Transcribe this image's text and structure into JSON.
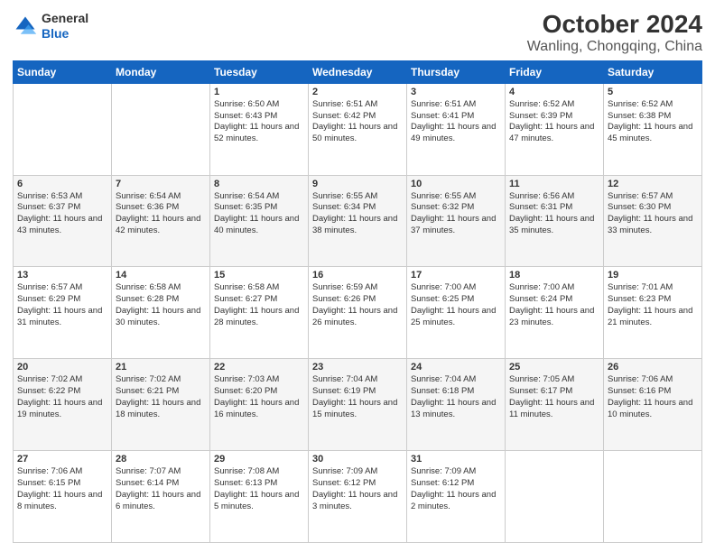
{
  "logo": {
    "general": "General",
    "blue": "Blue"
  },
  "header": {
    "title": "October 2024",
    "subtitle": "Wanling, Chongqing, China"
  },
  "days_of_week": [
    "Sunday",
    "Monday",
    "Tuesday",
    "Wednesday",
    "Thursday",
    "Friday",
    "Saturday"
  ],
  "weeks": [
    [
      {
        "day": "",
        "info": ""
      },
      {
        "day": "",
        "info": ""
      },
      {
        "day": "1",
        "info": "Sunrise: 6:50 AM\nSunset: 6:43 PM\nDaylight: 11 hours and 52 minutes."
      },
      {
        "day": "2",
        "info": "Sunrise: 6:51 AM\nSunset: 6:42 PM\nDaylight: 11 hours and 50 minutes."
      },
      {
        "day": "3",
        "info": "Sunrise: 6:51 AM\nSunset: 6:41 PM\nDaylight: 11 hours and 49 minutes."
      },
      {
        "day": "4",
        "info": "Sunrise: 6:52 AM\nSunset: 6:39 PM\nDaylight: 11 hours and 47 minutes."
      },
      {
        "day": "5",
        "info": "Sunrise: 6:52 AM\nSunset: 6:38 PM\nDaylight: 11 hours and 45 minutes."
      }
    ],
    [
      {
        "day": "6",
        "info": "Sunrise: 6:53 AM\nSunset: 6:37 PM\nDaylight: 11 hours and 43 minutes."
      },
      {
        "day": "7",
        "info": "Sunrise: 6:54 AM\nSunset: 6:36 PM\nDaylight: 11 hours and 42 minutes."
      },
      {
        "day": "8",
        "info": "Sunrise: 6:54 AM\nSunset: 6:35 PM\nDaylight: 11 hours and 40 minutes."
      },
      {
        "day": "9",
        "info": "Sunrise: 6:55 AM\nSunset: 6:34 PM\nDaylight: 11 hours and 38 minutes."
      },
      {
        "day": "10",
        "info": "Sunrise: 6:55 AM\nSunset: 6:32 PM\nDaylight: 11 hours and 37 minutes."
      },
      {
        "day": "11",
        "info": "Sunrise: 6:56 AM\nSunset: 6:31 PM\nDaylight: 11 hours and 35 minutes."
      },
      {
        "day": "12",
        "info": "Sunrise: 6:57 AM\nSunset: 6:30 PM\nDaylight: 11 hours and 33 minutes."
      }
    ],
    [
      {
        "day": "13",
        "info": "Sunrise: 6:57 AM\nSunset: 6:29 PM\nDaylight: 11 hours and 31 minutes."
      },
      {
        "day": "14",
        "info": "Sunrise: 6:58 AM\nSunset: 6:28 PM\nDaylight: 11 hours and 30 minutes."
      },
      {
        "day": "15",
        "info": "Sunrise: 6:58 AM\nSunset: 6:27 PM\nDaylight: 11 hours and 28 minutes."
      },
      {
        "day": "16",
        "info": "Sunrise: 6:59 AM\nSunset: 6:26 PM\nDaylight: 11 hours and 26 minutes."
      },
      {
        "day": "17",
        "info": "Sunrise: 7:00 AM\nSunset: 6:25 PM\nDaylight: 11 hours and 25 minutes."
      },
      {
        "day": "18",
        "info": "Sunrise: 7:00 AM\nSunset: 6:24 PM\nDaylight: 11 hours and 23 minutes."
      },
      {
        "day": "19",
        "info": "Sunrise: 7:01 AM\nSunset: 6:23 PM\nDaylight: 11 hours and 21 minutes."
      }
    ],
    [
      {
        "day": "20",
        "info": "Sunrise: 7:02 AM\nSunset: 6:22 PM\nDaylight: 11 hours and 19 minutes."
      },
      {
        "day": "21",
        "info": "Sunrise: 7:02 AM\nSunset: 6:21 PM\nDaylight: 11 hours and 18 minutes."
      },
      {
        "day": "22",
        "info": "Sunrise: 7:03 AM\nSunset: 6:20 PM\nDaylight: 11 hours and 16 minutes."
      },
      {
        "day": "23",
        "info": "Sunrise: 7:04 AM\nSunset: 6:19 PM\nDaylight: 11 hours and 15 minutes."
      },
      {
        "day": "24",
        "info": "Sunrise: 7:04 AM\nSunset: 6:18 PM\nDaylight: 11 hours and 13 minutes."
      },
      {
        "day": "25",
        "info": "Sunrise: 7:05 AM\nSunset: 6:17 PM\nDaylight: 11 hours and 11 minutes."
      },
      {
        "day": "26",
        "info": "Sunrise: 7:06 AM\nSunset: 6:16 PM\nDaylight: 11 hours and 10 minutes."
      }
    ],
    [
      {
        "day": "27",
        "info": "Sunrise: 7:06 AM\nSunset: 6:15 PM\nDaylight: 11 hours and 8 minutes."
      },
      {
        "day": "28",
        "info": "Sunrise: 7:07 AM\nSunset: 6:14 PM\nDaylight: 11 hours and 6 minutes."
      },
      {
        "day": "29",
        "info": "Sunrise: 7:08 AM\nSunset: 6:13 PM\nDaylight: 11 hours and 5 minutes."
      },
      {
        "day": "30",
        "info": "Sunrise: 7:09 AM\nSunset: 6:12 PM\nDaylight: 11 hours and 3 minutes."
      },
      {
        "day": "31",
        "info": "Sunrise: 7:09 AM\nSunset: 6:12 PM\nDaylight: 11 hours and 2 minutes."
      },
      {
        "day": "",
        "info": ""
      },
      {
        "day": "",
        "info": ""
      }
    ]
  ]
}
